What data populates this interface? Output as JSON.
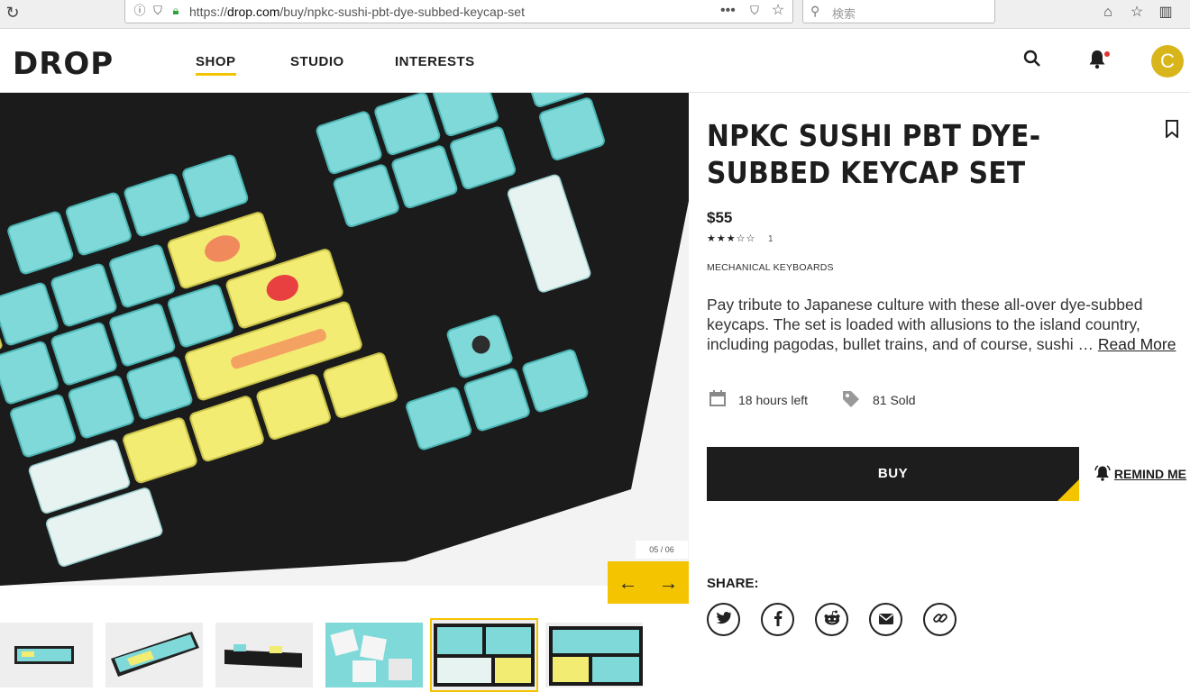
{
  "browser": {
    "url_prefix": "https://",
    "url_host": "drop.com",
    "url_path": "/buy/npkc-sushi-pbt-dye-subbed-keycap-set",
    "search_placeholder": "検索"
  },
  "header": {
    "logo": "DROP",
    "nav": [
      "SHOP",
      "STUDIO",
      "INTERESTS"
    ],
    "avatar_letter": "C"
  },
  "gallery": {
    "counter": "05 / 06",
    "prev_arrow": "←",
    "next_arrow": "→"
  },
  "product": {
    "title": "NPKC SUSHI PBT DYE-SUBBED KEYCAP SET",
    "price": "$55",
    "stars": "★★★☆☆",
    "review_count": "1",
    "category": "MECHANICAL KEYBOARDS",
    "description": "Pay tribute to Japanese culture with these all-over dye-subbed keycaps. The set is loaded with allusions to the island country, including pagodas, bullet trains, and of course, sushi … ",
    "read_more": "Read More",
    "time_left": "18 hours left",
    "sold": "81 Sold",
    "buy_label": "BUY",
    "remind_label": "REMIND ME",
    "share_label": "SHARE:"
  },
  "colors": {
    "accent": "#f5c400",
    "keycap_teal": "#7fd9d8",
    "keycap_yellow": "#f3ec73",
    "board": "#1b1b1b"
  }
}
